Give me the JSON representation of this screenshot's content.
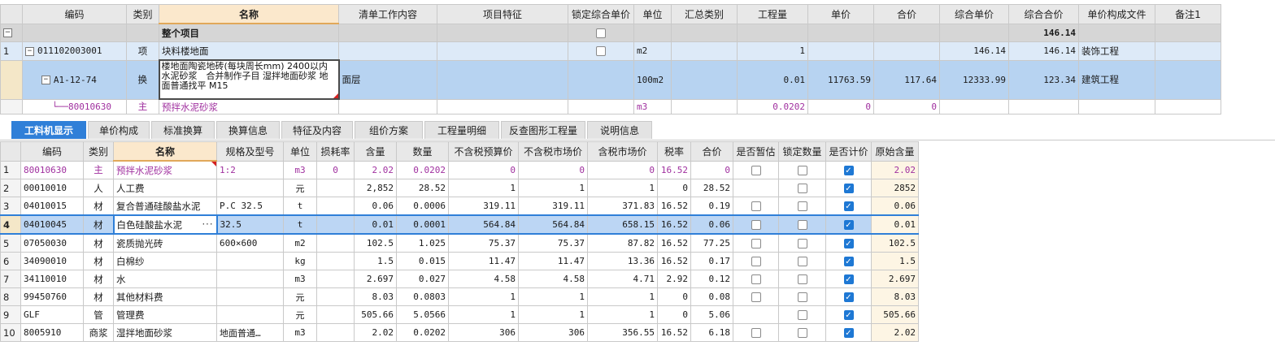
{
  "top_headers": [
    "",
    "编码",
    "类别",
    "名称",
    "清单工作内容",
    "项目特征",
    "锁定综合单价",
    "单位",
    "汇总类别",
    "工程量",
    "单价",
    "合价",
    "综合单价",
    "综合合价",
    "单价构成文件",
    "备注1"
  ],
  "top_total": {
    "name": "整个项目",
    "total": "146.14",
    "lock_checked": false
  },
  "top_item": {
    "row": "1",
    "code": "011102003001",
    "type": "项",
    "name": "块料楼地面",
    "lock_checked": false,
    "unit": "m2",
    "qty": "1",
    "unit_total": "146.14",
    "total": "146.14",
    "file": "装饰工程"
  },
  "top_sub": {
    "code": "A1-12-74",
    "type": "换",
    "name": "楼地面陶瓷地砖(每块周长mm) 2400以内 水泥砂浆　合并制作子目 湿拌地面砂浆 地面普通找平 M15",
    "work": "面层",
    "unit": "100m2",
    "qty": "0.01",
    "price": "11763.59",
    "amount": "117.64",
    "unit_total": "12333.99",
    "total": "123.34",
    "file": "建筑工程"
  },
  "top_mat": {
    "code": "80010630",
    "type": "主",
    "name": "预拌水泥砂浆",
    "unit": "m3",
    "qty": "0.0202",
    "price": "0",
    "amount": "0"
  },
  "tabs": [
    "工料机显示",
    "单价构成",
    "标准换算",
    "换算信息",
    "特征及内容",
    "组价方案",
    "工程量明细",
    "反查图形工程量",
    "说明信息"
  ],
  "bottom_headers": [
    "",
    "编码",
    "类别",
    "名称",
    "规格及型号",
    "单位",
    "损耗率",
    "含量",
    "数量",
    "不含税预算价",
    "不含税市场价",
    "含税市场价",
    "税率",
    "合价",
    "是否暂估",
    "锁定数量",
    "是否计价",
    "原始含量"
  ],
  "rows": [
    {
      "n": "1",
      "code": "80010630",
      "type": "主",
      "name": "预拌水泥砂浆",
      "spec": "1:2",
      "unit": "m3",
      "loss": "0",
      "content": "2.02",
      "qty": "0.0202",
      "budget": "0",
      "market": "0",
      "tax_market": "0",
      "tax": "16.52",
      "amount": "0",
      "est": false,
      "lock": false,
      "price": true,
      "orig": "2.02"
    },
    {
      "n": "2",
      "code": "00010010",
      "type": "人",
      "name": "人工费",
      "spec": "",
      "unit": "元",
      "loss": "",
      "content": "2,852",
      "qty": "28.52",
      "budget": "1",
      "market": "1",
      "tax_market": "1",
      "tax": "0",
      "amount": "28.52",
      "est": null,
      "lock": false,
      "price": true,
      "orig": "2852"
    },
    {
      "n": "3",
      "code": "04010015",
      "type": "材",
      "name": "复合普通硅酸盐水泥",
      "spec": "P.C 32.5",
      "unit": "t",
      "loss": "",
      "content": "0.06",
      "qty": "0.0006",
      "budget": "319.11",
      "market": "319.11",
      "tax_market": "371.83",
      "tax": "16.52",
      "amount": "0.19",
      "est": false,
      "lock": false,
      "price": true,
      "orig": "0.06"
    },
    {
      "n": "4",
      "code": "04010045",
      "type": "材",
      "name": "白色硅酸盐水泥",
      "spec": "32.5",
      "unit": "t",
      "loss": "",
      "content": "0.01",
      "qty": "0.0001",
      "budget": "564.84",
      "market": "564.84",
      "tax_market": "658.15",
      "tax": "16.52",
      "amount": "0.06",
      "est": false,
      "lock": false,
      "price": true,
      "orig": "0.01"
    },
    {
      "n": "5",
      "code": "07050030",
      "type": "材",
      "name": "瓷质抛光砖",
      "spec": "600×600",
      "unit": "m2",
      "loss": "",
      "content": "102.5",
      "qty": "1.025",
      "budget": "75.37",
      "market": "75.37",
      "tax_market": "87.82",
      "tax": "16.52",
      "amount": "77.25",
      "est": false,
      "lock": false,
      "price": true,
      "orig": "102.5"
    },
    {
      "n": "6",
      "code": "34090010",
      "type": "材",
      "name": "白棉纱",
      "spec": "",
      "unit": "kg",
      "loss": "",
      "content": "1.5",
      "qty": "0.015",
      "budget": "11.47",
      "market": "11.47",
      "tax_market": "13.36",
      "tax": "16.52",
      "amount": "0.17",
      "est": false,
      "lock": false,
      "price": true,
      "orig": "1.5"
    },
    {
      "n": "7",
      "code": "34110010",
      "type": "材",
      "name": "水",
      "spec": "",
      "unit": "m3",
      "loss": "",
      "content": "2.697",
      "qty": "0.027",
      "budget": "4.58",
      "market": "4.58",
      "tax_market": "4.71",
      "tax": "2.92",
      "amount": "0.12",
      "est": false,
      "lock": false,
      "price": true,
      "orig": "2.697"
    },
    {
      "n": "8",
      "code": "99450760",
      "type": "材",
      "name": "其他材料费",
      "spec": "",
      "unit": "元",
      "loss": "",
      "content": "8.03",
      "qty": "0.0803",
      "budget": "1",
      "market": "1",
      "tax_market": "1",
      "tax": "0",
      "amount": "0.08",
      "est": false,
      "lock": false,
      "price": true,
      "orig": "8.03"
    },
    {
      "n": "9",
      "code": "GLF",
      "type": "管",
      "name": "管理费",
      "spec": "",
      "unit": "元",
      "loss": "",
      "content": "505.66",
      "qty": "5.0566",
      "budget": "1",
      "market": "1",
      "tax_market": "1",
      "tax": "0",
      "amount": "5.06",
      "est": null,
      "lock": false,
      "price": true,
      "orig": "505.66"
    },
    {
      "n": "10",
      "code": "8005910",
      "type": "商浆",
      "name": "湿拌地面砂浆",
      "spec": "地面普通…",
      "unit": "m3",
      "loss": "",
      "content": "2.02",
      "qty": "0.0202",
      "budget": "306",
      "market": "306",
      "tax_market": "356.55",
      "tax": "16.52",
      "amount": "6.18",
      "est": false,
      "lock": false,
      "price": true,
      "orig": "2.02"
    }
  ],
  "icons": {
    "collapse": "minus-box-icon",
    "check": "checkmark-icon",
    "more": "ellipsis-icon"
  },
  "colors": {
    "selected_row": "#bcd6f4",
    "tab_active": "#2f7fd8",
    "main_material": "#a0309f",
    "checkbox_on": "#1e78d4"
  }
}
